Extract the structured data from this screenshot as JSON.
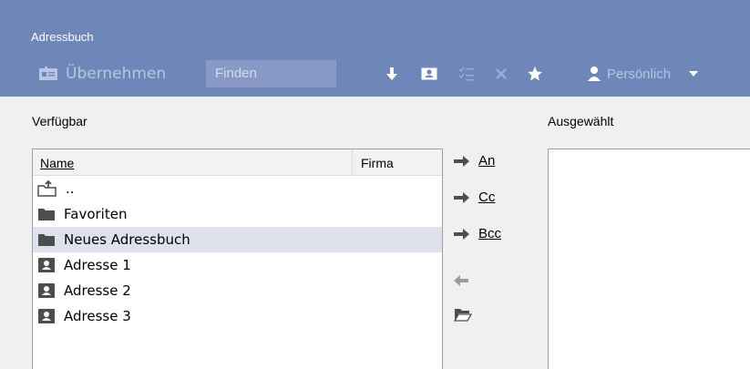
{
  "window": {
    "title": "Adressbuch"
  },
  "toolbar": {
    "accept_label": "Übernehmen",
    "find_placeholder": "Finden",
    "icons": [
      "download-icon",
      "contact-card-icon",
      "checklist-icon",
      "close-icon",
      "star-icon"
    ],
    "address_book_select": "Persönlich"
  },
  "available": {
    "label": "Verfügbar",
    "columns": {
      "name": "Name",
      "company": "Firma"
    },
    "rows": [
      {
        "name": "..",
        "icon": "parent-folder-icon"
      },
      {
        "name": "Favoriten",
        "icon": "folder-icon"
      },
      {
        "name": "Neues Adressbuch",
        "icon": "folder-icon",
        "selected": true
      },
      {
        "name": "Adresse 1",
        "icon": "contact-icon"
      },
      {
        "name": "Adresse 2",
        "icon": "contact-icon"
      },
      {
        "name": "Adresse 3",
        "icon": "contact-icon"
      }
    ]
  },
  "actions": {
    "to": "An",
    "cc": "Cc",
    "bcc": "Bcc"
  },
  "selected": {
    "label": "Ausgewählt"
  },
  "colors": {
    "header": "#6e86b8",
    "selection": "#dde2ec",
    "icon_gray": "#4d4d4d"
  }
}
